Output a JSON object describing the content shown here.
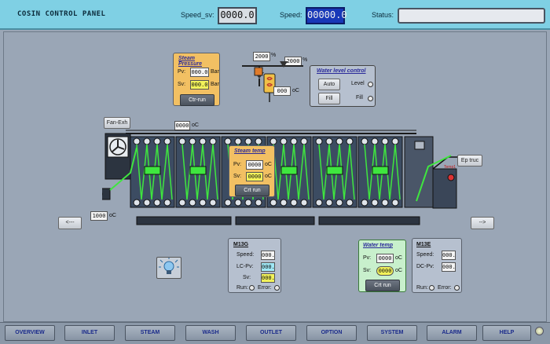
{
  "header": {
    "title": "COSIN CONTROL PANEL",
    "speed_sv_label": "Speed_sv:",
    "speed_sv_value": "0000.0",
    "speed_label": "Speed:",
    "speed_value": "00000.0",
    "status_label": "Status:",
    "status_value": ""
  },
  "steam_pressure": {
    "title": "Steam Pressure",
    "pv_label": "Pv:",
    "pv_value": "000.0",
    "sv_label": "Sv:",
    "sv_value": "000.0",
    "unit": "Bar",
    "button": "Ctr-run"
  },
  "valves": {
    "valve1_value": "2000",
    "valve1_unit": "%",
    "valve2_value": "2000",
    "valve2_unit": "%",
    "boiler_temp_value": "000",
    "boiler_temp_unit": "oC"
  },
  "water_level": {
    "title": "Water level control",
    "auto_button": "Auto",
    "fill_button": "Fill",
    "level_label": "Level",
    "fill_label": "Fill"
  },
  "machine": {
    "fan_button": "Fan-Exh",
    "top_temp_value": "0000",
    "top_temp_unit": "oC",
    "inlet_temp_value": "1000",
    "inlet_temp_unit": "oC",
    "ep_truc_button": "Ep truc",
    "sensor_label": "Temp1"
  },
  "steam_temp": {
    "title": "Steam temp",
    "pv_label": "Pv:",
    "pv_value": "0000",
    "sv_label": "Sv:",
    "sv_value": "0000",
    "unit": "oC",
    "button": "Crt run"
  },
  "nav_arrows": {
    "left": "<---",
    "right": "-->"
  },
  "m13g": {
    "title": "M13G",
    "speed_label": "Speed:",
    "speed_value": "000.",
    "lc_label": "LC-Pv:",
    "lc_value": "000.",
    "sv_label": "Sv:",
    "sv_value": "000.",
    "run_label": "Run:",
    "error_label": "Error:"
  },
  "water_temp": {
    "title": "Water temp",
    "pv_label": "Pv:",
    "pv_value": "0000",
    "sv_label": "Sv:",
    "sv_value": "0000",
    "unit": "oC",
    "button": "Crt run"
  },
  "m13e": {
    "title": "M13E",
    "speed_label": "Speed:",
    "speed_value": "000.",
    "dc_label": "DC-Pv:",
    "dc_value": "000.",
    "run_label": "Run:",
    "error_label": "Error:"
  },
  "nav": [
    "OVERVIEW",
    "INLET",
    "STEAM",
    "WASH",
    "OUTLET",
    "OPTION",
    "SYSTEM",
    "ALARM",
    "HELP"
  ],
  "colors": {
    "header_bg": "#7fd0e4",
    "body_bg": "#9aa6b6",
    "steam_pressure_bg": "#f2c063",
    "water_temp_bg": "#c8f0cc",
    "speed_blue": "#1838b8",
    "flow_green": "#3fe63f"
  }
}
